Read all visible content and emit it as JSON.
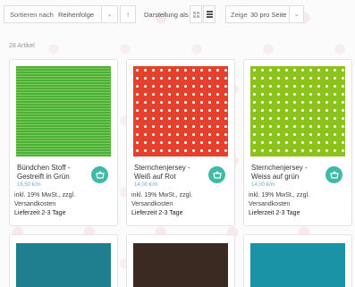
{
  "toolbar": {
    "sort_label": "Sortieren nach",
    "sort_value": "Reihenfolge",
    "order_arrow": "↑",
    "view_label": "Darstellung als",
    "per_page_label": "Zeige",
    "per_page_value": "30 pro Seite"
  },
  "article_count": "28 Artikel",
  "products": [
    {
      "name": "Bündchen Stoff - Gestreift in Grün",
      "price": "16,50 €/m",
      "tax": "inkl. 19% MwSt., zzgl. Versandkosten",
      "delivery": "Lieferzeit 2-3 Tage"
    },
    {
      "name": "Sternchenjersey - Weiß auf Rot",
      "price": "14,00 €/m",
      "tax": "inkl. 19% MwSt., zzgl. Versandkosten",
      "delivery": "Lieferzeit 2-3 Tage"
    },
    {
      "name": "Sternchenjersey - Weiss auf grün",
      "price": "14,00 €/m",
      "tax": "inkl. 19% MwSt., zzgl. Versandkosten",
      "delivery": "Lieferzeit 2-3 Tage"
    }
  ],
  "colors": {
    "accent": "#3fbaa7",
    "price": "#6ab0c8",
    "swatch_bottom_1": "#1f7f8f",
    "swatch_bottom_2": "#3a2a22",
    "swatch_bottom_3": "#1b93a6"
  },
  "icons": {
    "cart": "basket-icon",
    "chevron": "chevron-down-icon",
    "grid": "grid-view-icon",
    "list": "list-view-icon"
  }
}
